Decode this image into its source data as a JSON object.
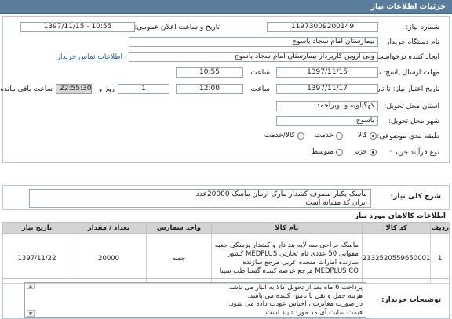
{
  "header": {
    "title": "جزئیات اطلاعات نیاز"
  },
  "form": {
    "need_number_label": "شماره نیاز:",
    "need_number": "11973009200149",
    "announce_label": "تاریخ و ساعت اعلان عمومی:",
    "announce_value": "1397/11/15 - 10:55",
    "buyer_org_label": "نام دستگاه خریدار:",
    "buyer_org": "بیمارستان امام سجاد یاسوج",
    "creator_label": "ایجاد کننده درخواست:",
    "creator": "ولی آزوین کارپرداز بیمارستان امام سجاد یاسوج",
    "contact_link": "اطلاعات تماس خریدار",
    "send_deadline_label": "مهلت ارسال پاسخ: تا تاریخ:",
    "send_date": "1397/11/15",
    "time_label": "ساعت",
    "send_time": "10:55",
    "validity_label": "تاریخ اعتبار نیاز: تا تاریخ:",
    "validity_date": "1397/11/17",
    "validity_time": "12:00",
    "days_value": "1",
    "days_label": "روز و",
    "remaining_time": "22:55:30",
    "remaining_label": "ساعت باقی مانده",
    "province_label": "استان محل تحویل:",
    "province": "کهگیلویه و بویراحمد",
    "city_label": "شهر محل تحویل:",
    "city": "یاسوج",
    "category_label": "طبقه بندی موضوعی:",
    "category_options": [
      "کالا",
      "خدمت",
      "کالا/خدمت"
    ],
    "process_label": "نوع فرآیند خرید :",
    "process_options": [
      "جزیی",
      "متوسط"
    ]
  },
  "description": {
    "label": "شرح کلی نیاز:",
    "lines": [
      "ماسک یکبار مصرف کشدار مارک ارمان ماسک 20000عدد",
      "ایران کد مشابه است"
    ]
  },
  "items_section": {
    "title": "اطلاعات کالاهای مورد نیاز",
    "headers": [
      "ردیف",
      "کد کالا",
      "نام کالا",
      "واحد شمارش",
      "تعداد / مقدار",
      "تاریخ نیاز"
    ],
    "rows": [
      {
        "index": "1",
        "code": "2132520559650001",
        "name": "ماسک جراحی سه لایه بند دار و کشدار پزشکی جعبه مقوایی 50 عددی نام تجارتی MEDPLUS کشور سازنده امارات متحده عربی مرجع سازنده MEDPLUS CO مرجع عرضه کننده گستا طب سینا",
        "unit": "جعبه",
        "quantity": "20000",
        "date": "1397/11/22"
      }
    ]
  },
  "notes": {
    "label": "توضیحات خریدار:",
    "lines": [
      "پرداخت 6 ماه بعد از تحویل کالا به انبار می باشد.",
      "هزینه حمل و نقل با تامین کننده می باشد.",
      "در صورت مغایرت ، اجناس عودت داده می شود.",
      "قیمت سایت آی مد مورد تایید است."
    ]
  }
}
